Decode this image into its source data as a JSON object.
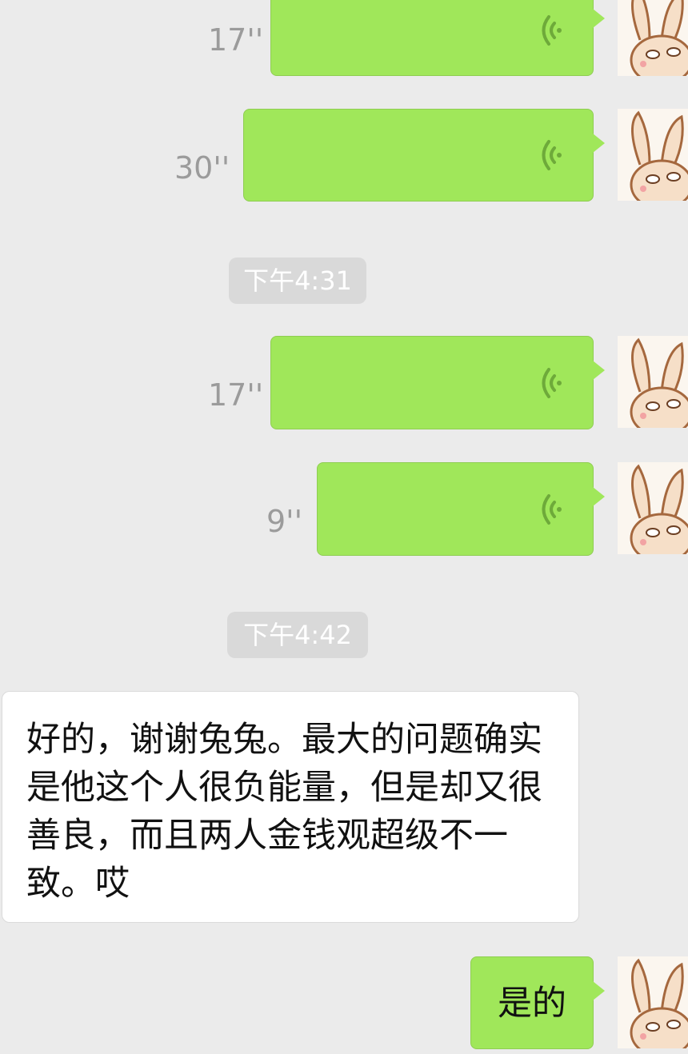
{
  "voice_messages": [
    {
      "duration": "17''"
    },
    {
      "duration": "30''"
    },
    {
      "duration": "17''"
    },
    {
      "duration": "9''"
    }
  ],
  "time_separators": [
    "下午4:31",
    "下午4:42"
  ],
  "incoming_message": {
    "text": "好的，谢谢兔兔。最大的问题确实是他这个人很负能量，但是却又很善良，而且两人金钱观超级不一致。哎"
  },
  "outgoing_text_message": {
    "text": "是的"
  },
  "colors": {
    "background": "#ebebeb",
    "outgoing_bubble": "#a0e75a",
    "incoming_bubble": "#ffffff",
    "time_badge": "#d9d9d9",
    "duration_text": "#9b9b9b"
  },
  "icons": [
    "voice-wave-icon",
    "rabbit-avatar"
  ]
}
